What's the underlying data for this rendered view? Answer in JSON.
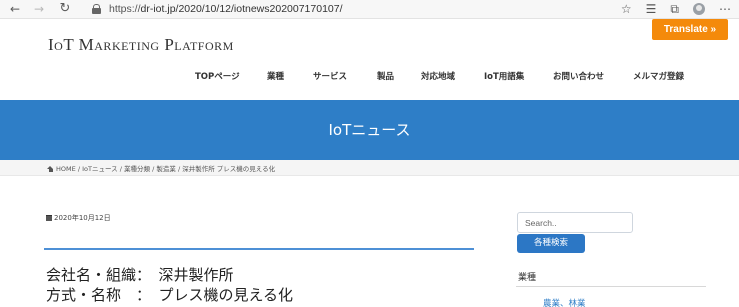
{
  "browser": {
    "url_protocol": "https://",
    "url_rest": "dr-iot.jp/2020/10/12/iotnews202007170107/",
    "icons": [
      "back-icon",
      "forward-icon",
      "reload-icon",
      "lock-icon",
      "star-icon",
      "favorites-icon",
      "collections-icon",
      "profile-icon",
      "more-icon"
    ]
  },
  "translate": {
    "label": "Translate »",
    "color": "#f48a0b"
  },
  "site": {
    "title": "IoT Marketing Platform"
  },
  "nav": {
    "items": [
      "TOPページ",
      "業種",
      "サービス",
      "製品",
      "対応地域",
      "IoT用語集",
      "お問い合わせ",
      "メルマガ登録"
    ]
  },
  "banner": {
    "title": "IoTニュース",
    "color": "#2e7ec7"
  },
  "breadcrumb": {
    "home": "HOME",
    "items": [
      "IoTニュース",
      "業種分類",
      "製造業",
      "深井製作所 プレス機の見える化"
    ],
    "separator": "/"
  },
  "article": {
    "date": "2020年10月12日",
    "line1": "会社名・組織：　深井製作所",
    "line2": "方式・名称　：　プレス機の見える化"
  },
  "sidebar": {
    "search_placeholder": "Search..",
    "search_button": "各種検索",
    "section_title": "業種",
    "first_item": "農業、林業"
  }
}
